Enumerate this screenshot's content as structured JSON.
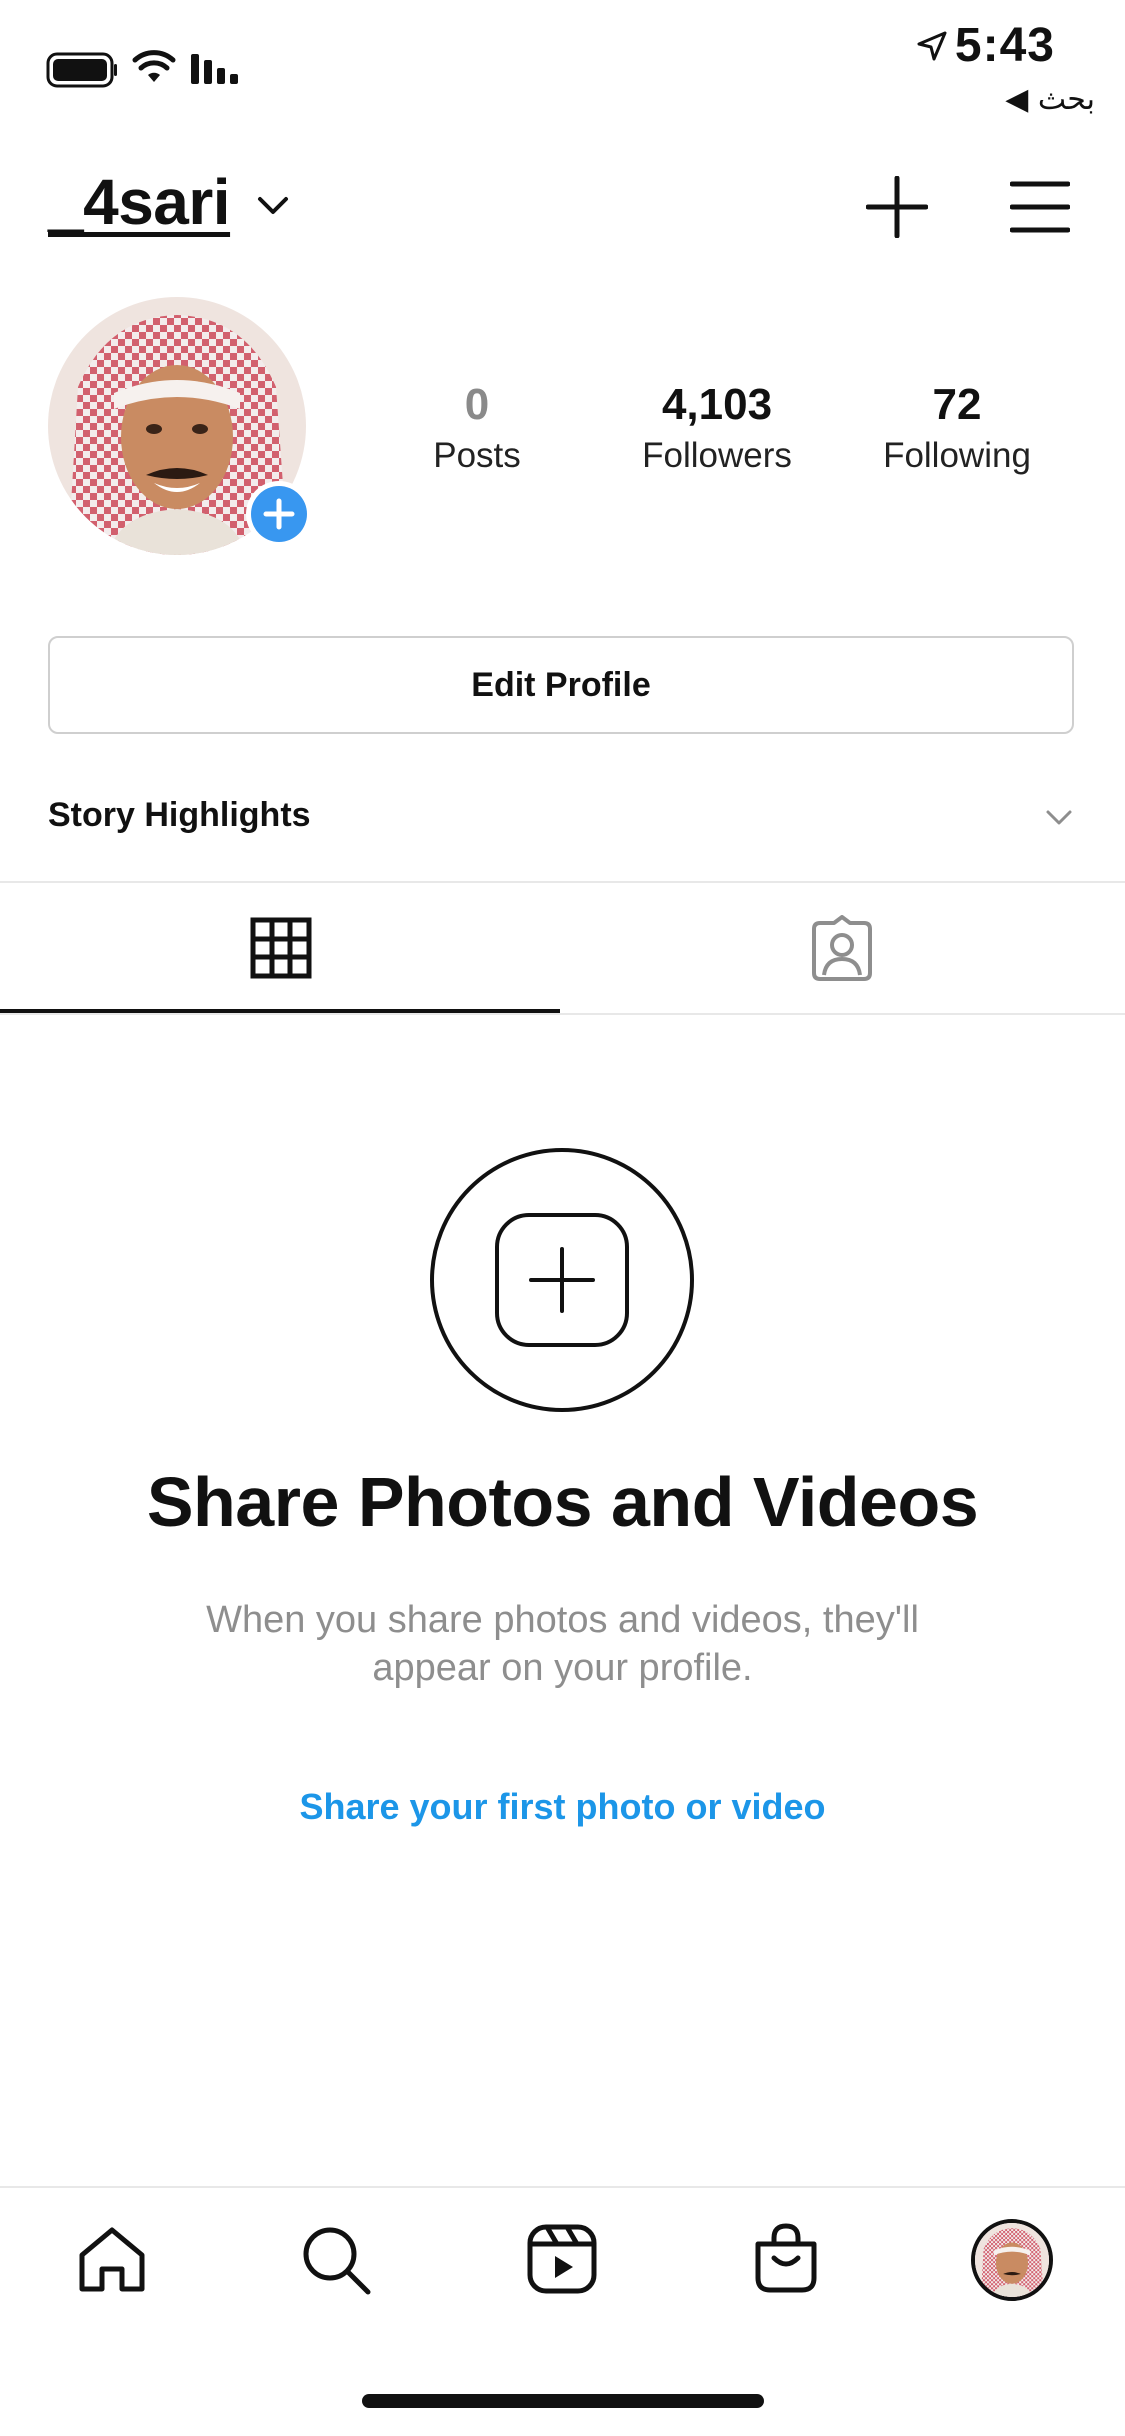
{
  "status_bar": {
    "time": "5:43",
    "back_label": "◀ بحث",
    "icons": [
      "battery-icon",
      "wifi-icon",
      "signal-icon",
      "location-arrow-icon"
    ]
  },
  "header": {
    "username": "_4sari",
    "icons": [
      "chevron-down-icon",
      "plus-icon",
      "menu-icon"
    ]
  },
  "profile": {
    "stats": [
      {
        "value": "0",
        "label": "Posts"
      },
      {
        "value": "4,103",
        "label": "Followers"
      },
      {
        "value": "72",
        "label": "Following"
      }
    ],
    "edit_profile_label": "Edit Profile",
    "story_highlights_label": "Story Highlights"
  },
  "tabs": [
    {
      "icon": "grid-icon",
      "active": true
    },
    {
      "icon": "tagged-icon",
      "active": false
    }
  ],
  "empty_state": {
    "title": "Share Photos and Videos",
    "description": "When you share photos and videos, they'll appear on your profile.",
    "link": "Share your first photo or video"
  },
  "bottom_nav": [
    "home-icon",
    "search-icon",
    "reels-icon",
    "shop-icon",
    "profile-avatar"
  ],
  "colors": {
    "accent_blue": "#3897f0",
    "link_blue": "#1c96e8",
    "text": "#111111",
    "muted": "#8e8e8e",
    "border": "#cfcfcf"
  }
}
